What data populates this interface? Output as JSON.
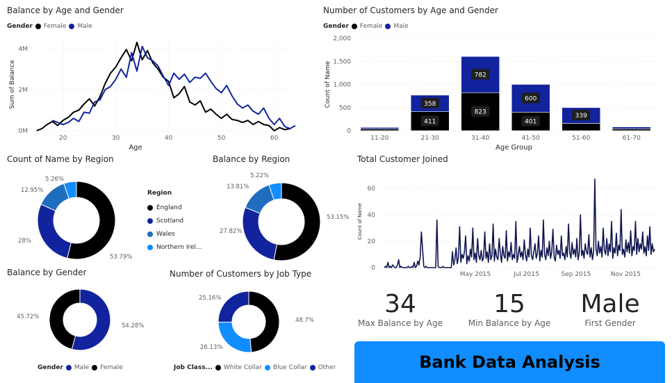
{
  "colors": {
    "female": "#000000",
    "male": "#12239e",
    "england": "#000000",
    "scotland": "#12239e",
    "wales": "#1f6dbf",
    "northern_ireland": "#118dff",
    "white_collar": "#000000",
    "blue_collar": "#118dff",
    "other": "#12239e",
    "timeline": "#0d1450"
  },
  "legend_gender": {
    "label": "Gender",
    "female": "Female",
    "male": "Male"
  },
  "region_legend": {
    "label": "Region",
    "items": [
      "England",
      "Scotland",
      "Wales",
      "Northern Irel..."
    ]
  },
  "job_legend": {
    "label": "Job Class...",
    "items": [
      "White Collar",
      "Blue Collar",
      "Other"
    ]
  },
  "kpis": [
    {
      "value": "34",
      "label": "Max Balance by Age"
    },
    {
      "value": "15",
      "label": "Min Balance by Age"
    },
    {
      "value": "Male",
      "label": "First Gender"
    }
  ],
  "banner": {
    "text": "Bank Data Analysis"
  },
  "chart_data": [
    {
      "id": "balance-age-gender",
      "type": "line",
      "title": "Balance by Age and Gender",
      "xlabel": "Age",
      "ylabel": "Sum of Balance",
      "xlim": [
        14,
        64
      ],
      "ylim": [
        0,
        4500000
      ],
      "xticks": [
        20,
        30,
        40,
        50,
        60
      ],
      "yticks": [
        {
          "v": 0,
          "t": "0M"
        },
        {
          "v": 2000000,
          "t": "2M"
        },
        {
          "v": 4000000,
          "t": "4M"
        }
      ],
      "series": [
        {
          "name": "Female",
          "x": [
            15,
            16,
            17,
            18,
            19,
            20,
            21,
            22,
            23,
            24,
            25,
            26,
            27,
            28,
            29,
            30,
            31,
            32,
            33,
            34,
            35,
            36,
            37,
            38,
            39,
            40,
            41,
            42,
            43,
            44,
            45,
            46,
            47,
            48,
            49,
            50,
            51,
            52,
            53,
            54,
            55,
            56,
            57,
            58,
            59,
            60,
            61,
            62,
            63
          ],
          "y": [
            0,
            100000,
            300000,
            450000,
            250000,
            500000,
            650000,
            900000,
            1000000,
            1300000,
            1550000,
            1200000,
            1650000,
            2300000,
            2800000,
            3100000,
            3550000,
            3950000,
            3400000,
            4300000,
            3450000,
            3900000,
            3300000,
            3000000,
            2600000,
            2400000,
            1600000,
            1800000,
            2150000,
            1400000,
            1250000,
            1450000,
            900000,
            1050000,
            800000,
            600000,
            800000,
            550000,
            500000,
            400000,
            500000,
            300000,
            450000,
            300000,
            250000,
            0,
            150000,
            50000,
            100000
          ]
        },
        {
          "name": "Male",
          "x": [
            18,
            19,
            20,
            21,
            22,
            23,
            24,
            25,
            26,
            27,
            28,
            29,
            30,
            31,
            32,
            33,
            34,
            35,
            36,
            37,
            38,
            39,
            40,
            41,
            42,
            43,
            44,
            45,
            46,
            47,
            48,
            49,
            50,
            51,
            52,
            53,
            54,
            55,
            56,
            57,
            58,
            59,
            60,
            61,
            62,
            63,
            64
          ],
          "y": [
            500000,
            400000,
            300000,
            400000,
            600000,
            450000,
            900000,
            850000,
            1400000,
            1500000,
            2000000,
            2150000,
            2500000,
            3000000,
            2600000,
            3800000,
            2900000,
            4100000,
            3550000,
            3400000,
            3150000,
            2650000,
            2200000,
            2800000,
            2500000,
            2750000,
            2350000,
            2600000,
            2550000,
            2800000,
            2400000,
            2050000,
            1850000,
            2200000,
            1700000,
            1300000,
            1100000,
            1250000,
            950000,
            800000,
            1100000,
            600000,
            300000,
            600000,
            200000,
            100000,
            250000
          ]
        }
      ]
    },
    {
      "id": "customers-age-gender",
      "type": "bar",
      "stacked": true,
      "title": "Number of Customers by Age and Gender",
      "xlabel": "Age Group",
      "ylabel": "Count of Name",
      "ylim": [
        0,
        2000
      ],
      "yticks": [
        0,
        500,
        1000,
        1500,
        2000
      ],
      "ytick_labels": [
        "0",
        "500",
        "1,000",
        "1,500",
        "2,000"
      ],
      "categories": [
        "11-20",
        "21-30",
        "31-40",
        "41-50",
        "51-60",
        "61-70"
      ],
      "series": [
        {
          "name": "Female",
          "values": [
            40,
            411,
            823,
            401,
            160,
            40
          ],
          "labels": [
            "",
            "411",
            "823",
            "401",
            "",
            ""
          ]
        },
        {
          "name": "Male",
          "values": [
            30,
            358,
            782,
            600,
            339,
            40
          ],
          "labels": [
            "",
            "358",
            "782",
            "600",
            "339",
            ""
          ]
        }
      ]
    },
    {
      "id": "count-by-region",
      "type": "pie",
      "donut": true,
      "title": "Count of Name by Region",
      "labels": [
        "England",
        "Scotland",
        "Wales",
        "Northern Irel..."
      ],
      "values": [
        53.79,
        28,
        12.95,
        5.26
      ],
      "value_labels": [
        "53.79%",
        "28%",
        "12.95%",
        "5.26%"
      ]
    },
    {
      "id": "balance-by-region",
      "type": "pie",
      "donut": true,
      "title": "Balance by Region",
      "labels": [
        "England",
        "Scotland",
        "Wales",
        "Northern Irel..."
      ],
      "values": [
        53.15,
        27.82,
        13.81,
        5.22
      ],
      "value_labels": [
        "53.15%",
        "27.82%",
        "13.81%",
        "5.22%"
      ]
    },
    {
      "id": "balance-by-gender",
      "type": "pie",
      "donut": true,
      "title": "Balance by Gender",
      "labels": [
        "Male",
        "Female"
      ],
      "values": [
        54.28,
        45.72
      ],
      "value_labels": [
        "54.28%",
        "45.72%"
      ]
    },
    {
      "id": "customers-by-job",
      "type": "pie",
      "donut": true,
      "title": "Number of Customers by Job Type",
      "labels": [
        "White Collar",
        "Blue Collar",
        "Other"
      ],
      "values": [
        48.7,
        26.13,
        25.16
      ],
      "value_labels": [
        "48.7%",
        "26.13%",
        "25.16%"
      ]
    },
    {
      "id": "customers-joined",
      "type": "line",
      "title": "Total Customer Joined",
      "ylabel": "Count of Name",
      "ylim": [
        0,
        70
      ],
      "yticks": [
        0,
        20,
        40,
        60
      ],
      "xtick_labels": [
        "May 2015",
        "Jul 2015",
        "Sep 2015",
        "Nov 2015"
      ],
      "x_start": "2015-01-01",
      "x_end": "2015-12-31",
      "values": [
        0,
        1,
        0,
        4,
        0,
        1,
        0,
        2,
        1,
        0,
        0,
        2,
        6,
        0,
        1,
        0,
        0,
        0,
        0,
        0,
        1,
        0,
        0,
        1,
        0,
        4,
        0,
        1,
        5,
        2,
        8,
        27,
        14,
        1,
        0,
        1,
        0,
        0,
        0,
        0,
        0,
        0,
        0,
        0,
        36,
        1,
        0,
        0,
        0,
        1,
        0,
        0,
        0,
        0,
        0,
        0,
        0,
        12,
        2,
        6,
        15,
        3,
        8,
        31,
        4,
        10,
        7,
        12,
        24,
        3,
        9,
        5,
        14,
        8,
        30,
        6,
        11,
        4,
        22,
        9,
        6,
        13,
        5,
        8,
        27,
        7,
        12,
        4,
        18,
        6,
        9,
        33,
        5,
        14,
        8,
        6,
        22,
        11,
        4,
        16,
        9,
        7,
        28,
        5,
        12,
        8,
        19,
        6,
        10,
        7,
        35,
        4,
        9,
        16,
        8,
        12,
        6,
        21,
        10,
        5,
        14,
        8,
        30,
        9,
        6,
        12,
        18,
        7,
        11,
        24,
        5,
        13,
        8,
        36,
        10,
        6,
        15,
        9,
        20,
        7,
        12,
        29,
        8,
        5,
        17,
        10,
        13,
        7,
        24,
        9,
        11,
        6,
        16,
        8,
        33,
        12,
        7,
        19,
        10,
        14,
        8,
        22,
        6,
        11,
        40,
        9,
        13,
        7,
        18,
        12,
        10,
        25,
        8,
        15,
        6,
        12,
        67,
        14,
        9,
        20,
        11,
        16,
        8,
        30,
        13,
        10,
        22,
        9,
        18,
        12,
        35,
        7,
        15,
        11,
        26,
        9,
        17,
        13,
        44,
        10,
        14,
        8,
        21,
        12,
        19,
        11,
        28,
        9,
        16,
        13,
        35,
        10,
        22,
        12,
        18,
        14,
        27,
        11,
        16,
        9,
        24,
        13,
        31,
        10,
        18,
        12,
        14
      ]
    }
  ]
}
